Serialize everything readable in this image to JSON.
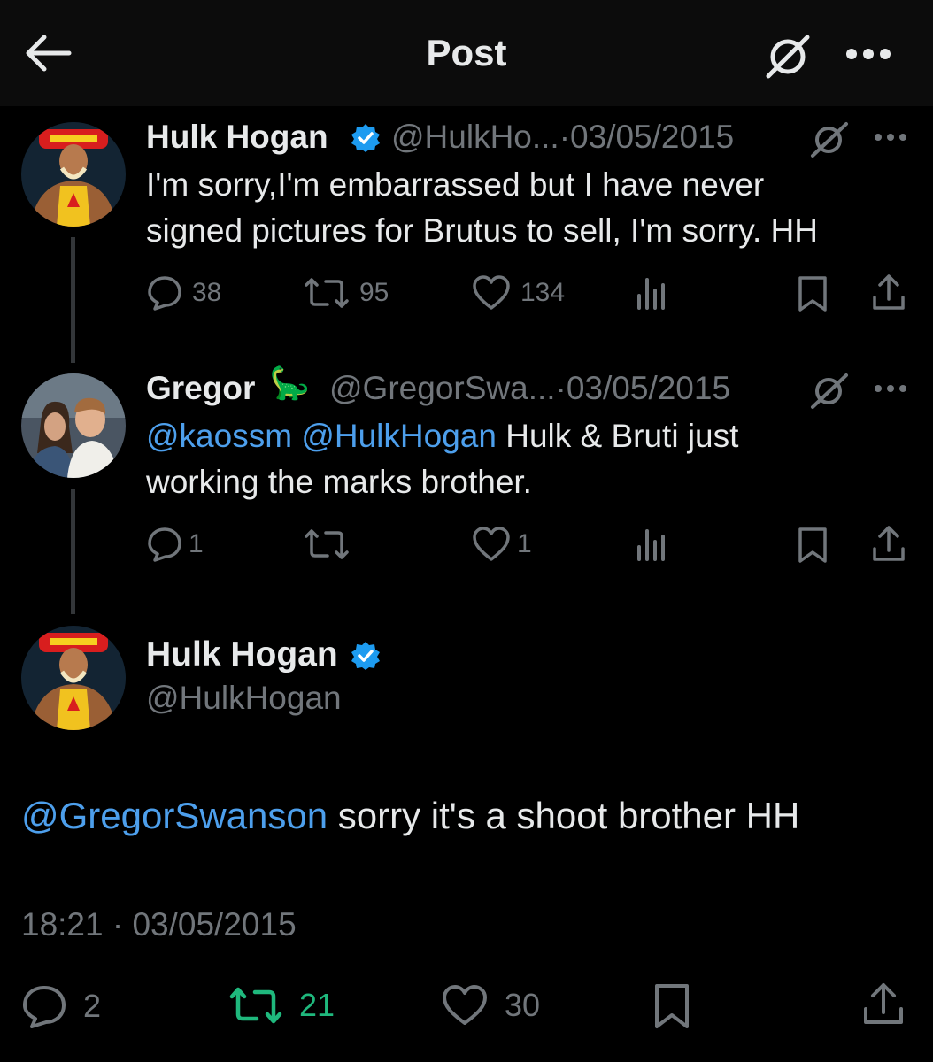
{
  "header": {
    "title": "Post"
  },
  "thread": [
    {
      "name": "Hulk Hogan",
      "handle": "@HulkHo...",
      "separator": "·",
      "date": "03/05/2015",
      "text_lines": [
        "I'm sorry,I'm embarrassed but I have never",
        "signed pictures for Brutus to sell, I'm sorry. HH"
      ],
      "replies": "38",
      "reposts": "95",
      "likes": "134"
    },
    {
      "name": "Gregor",
      "emoji": "🦕",
      "handle": "@GregorSwa...",
      "separator": "·",
      "date": "03/05/2015",
      "mention1": "@kaossm",
      "mention2": "@HulkHogan",
      "text_line1_rest": " Hulk & Bruti just",
      "text_line2": "working the marks brother.",
      "replies": "1",
      "likes": "1"
    }
  ],
  "main": {
    "name": "Hulk Hogan",
    "handle": "@HulkHogan",
    "mention": "@GregorSwanson",
    "text_rest": " sorry it's a shoot brother HH",
    "timestamp": "18:21 · 03/05/2015",
    "replies": "2",
    "reposts": "21",
    "likes": "30"
  },
  "colors": {
    "background": "#000000",
    "link": "#4d9fec",
    "muted": "#71767b",
    "verified": "#1d9bf0",
    "repost_active": "#1fb87d"
  },
  "icons": [
    "back-arrow-icon",
    "grok-icon",
    "more-icon",
    "verified-badge-icon",
    "reply-icon",
    "repost-icon",
    "like-icon",
    "views-icon",
    "bookmark-icon",
    "share-icon"
  ]
}
